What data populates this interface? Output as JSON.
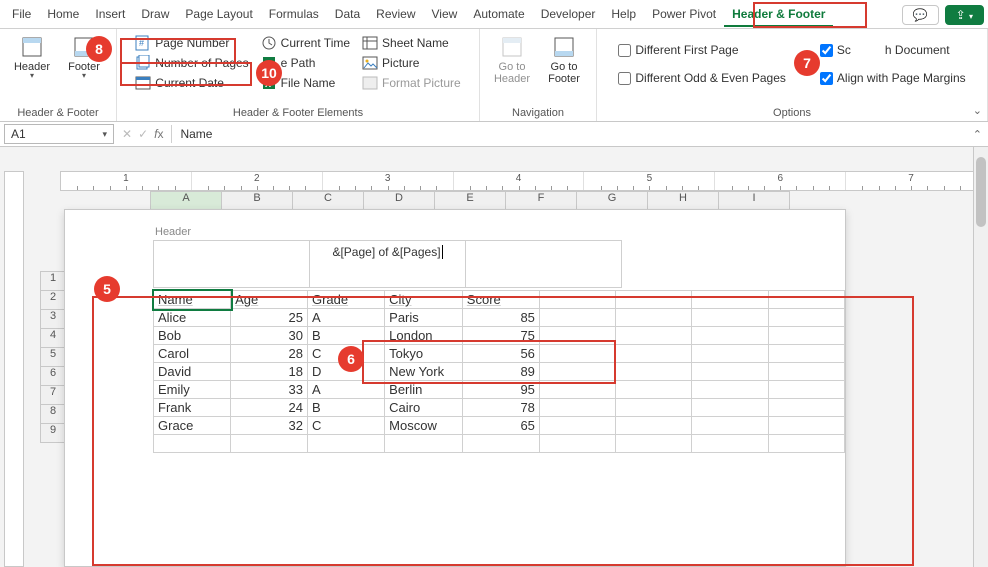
{
  "tabs": [
    "File",
    "Home",
    "Insert",
    "Draw",
    "Page Layout",
    "Formulas",
    "Data",
    "Review",
    "View",
    "Automate",
    "Developer",
    "Help",
    "Power Pivot",
    "Header & Footer"
  ],
  "active_tab": "Header & Footer",
  "comment_btn": "▢",
  "ribbon": {
    "hf_group": "Header & Footer",
    "hf_elements_group": "Header & Footer Elements",
    "nav_group": "Navigation",
    "options_group": "Options",
    "header_btn": "Header",
    "footer_btn": "Footer",
    "page_number": "Page Number",
    "number_of_pages": "Number of Pages",
    "current_date": "Current Date",
    "current_time": "Current Time",
    "file_path": "e Path",
    "file_name": "File Name",
    "sheet_name": "Sheet Name",
    "picture": "Picture",
    "format_picture": "Format Picture",
    "goto_header": "Go to Header",
    "goto_footer": "Go to Footer",
    "diff_first": "Different First Page",
    "diff_odd_even": "Different Odd & Even Pages",
    "scale_doc": "h Document",
    "align_margins": "Align with Page Margins",
    "scale_prefix": "Sc"
  },
  "namebox": "A1",
  "formula": "Name",
  "ruler_segments": [
    1,
    2,
    3,
    4,
    5,
    6,
    7
  ],
  "columns": [
    "A",
    "B",
    "C",
    "D",
    "E",
    "F",
    "G",
    "H",
    "I"
  ],
  "row_numbers": [
    1,
    2,
    3,
    4,
    5,
    6,
    7,
    8,
    9
  ],
  "header_label": "Header",
  "header_center": "&[Page] of &[Pages]",
  "table": {
    "headers": [
      "Name",
      "Age",
      "Grade",
      "City",
      "Score"
    ],
    "rows": [
      [
        "Alice",
        "25",
        "A",
        "Paris",
        "85"
      ],
      [
        "Bob",
        "30",
        "B",
        "London",
        "75"
      ],
      [
        "Carol",
        "28",
        "C",
        "Tokyo",
        "56"
      ],
      [
        "David",
        "18",
        "D",
        "New York",
        "89"
      ],
      [
        "Emily",
        "33",
        "A",
        "Berlin",
        "95"
      ],
      [
        "Frank",
        "24",
        "B",
        "Cairo",
        "78"
      ],
      [
        "Grace",
        "32",
        "C",
        "Moscow",
        "65"
      ]
    ]
  },
  "annotations": {
    "a5": "5",
    "a6": "6",
    "a7": "7",
    "a8": "8",
    "a10": "10"
  }
}
